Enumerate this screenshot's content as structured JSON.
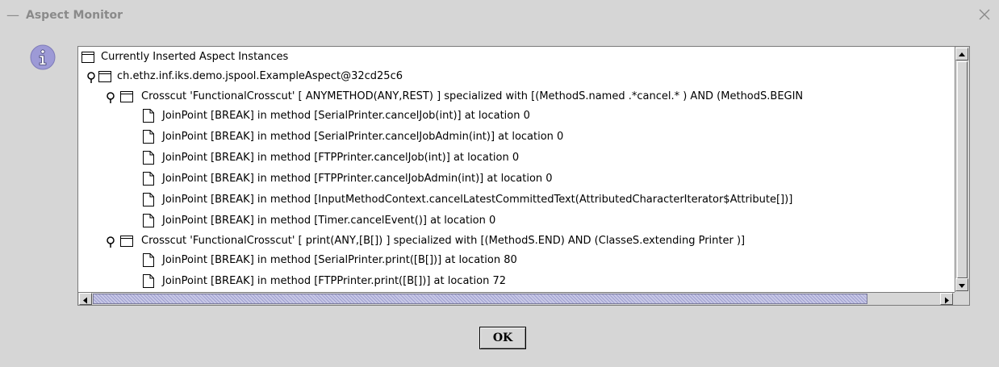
{
  "window": {
    "title": "Aspect Monitor",
    "close_glyph": "×"
  },
  "icons": {
    "dialog": "info-icon",
    "folder": "folder-icon",
    "file": "file-icon",
    "expander": "expanded-node-handle-icon"
  },
  "tree": {
    "root_label": "Currently Inserted Aspect Instances",
    "aspect_label": "ch.ethz.inf.iks.demo.jspool.ExampleAspect@32cd25c6",
    "crosscuts": [
      {
        "label": "Crosscut 'FunctionalCrosscut' [ ANYMETHOD(ANY,REST) ] specialized with [(MethodS.named .*cancel.* ) AND (MethodS.BEGIN",
        "joinpoints": [
          "JoinPoint [BREAK] in method [SerialPrinter.cancelJob(int)] at location 0",
          "JoinPoint [BREAK] in method [SerialPrinter.cancelJobAdmin(int)] at location 0",
          "JoinPoint [BREAK] in method [FTPPrinter.cancelJob(int)] at location 0",
          "JoinPoint [BREAK] in method [FTPPrinter.cancelJobAdmin(int)] at location 0",
          "JoinPoint [BREAK] in method [InputMethodContext.cancelLatestCommittedText(AttributedCharacterIterator$Attribute[])]",
          "JoinPoint [BREAK] in method [Timer.cancelEvent()] at location 0"
        ]
      },
      {
        "label": "Crosscut 'FunctionalCrosscut' [ print(ANY,[B[]) ] specialized with [(MethodS.END) AND (ClasseS.extending Printer )]",
        "joinpoints": [
          "JoinPoint [BREAK] in method [SerialPrinter.print([B[])] at location 80",
          "JoinPoint [BREAK] in method [FTPPrinter.print([B[])] at location 72"
        ]
      }
    ]
  },
  "buttons": {
    "ok_label": "OK"
  },
  "colors": {
    "window_bg": "#d6d6d6",
    "info_icon": "#9d9ad6",
    "scroll_thumb": "#c8c8e6"
  }
}
